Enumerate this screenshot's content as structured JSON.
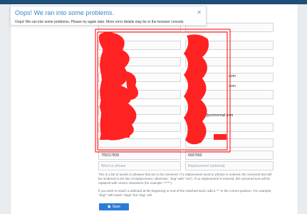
{
  "alert": {
    "title": "Oops! We ran into some problems.",
    "message": "Oops! We ran into some problems. Please try again later. More error details may be in the browser console.",
    "close_icon": "close-icon"
  },
  "table": {
    "visible_rows": [
      {
        "left": "705217828",
        "right": "6007660"
      }
    ],
    "new_row": {
      "left_placeholder": "Word or phrase",
      "right_placeholder": "Replacement (optional)"
    }
  },
  "partial_emails": [
    ".com",
    ".com",
    "@protonmail.com"
  ],
  "help": {
    "p1": "This is a list of words or phrases that are to be censored. If a replacement word or phrase is entered, the censored text will be rendered in the line of replacement; otherwise, \"dog\" with \"cat\"). If no replacement is entered, the censored text will be replaced with censor characters (for example \"****\").",
    "p2": "If you wish to match a wildcard at the beginning or end of the matched word, add a \"*\" in the correct position. For example, \"dog*\" will match \"dogs\" but \"dog\" will."
  },
  "save_button": {
    "label": "Save",
    "icon": "save-icon"
  },
  "colors": {
    "accent": "#2b7bd6",
    "redaction": "#ff0000",
    "alert_title": "#3a86c8"
  }
}
